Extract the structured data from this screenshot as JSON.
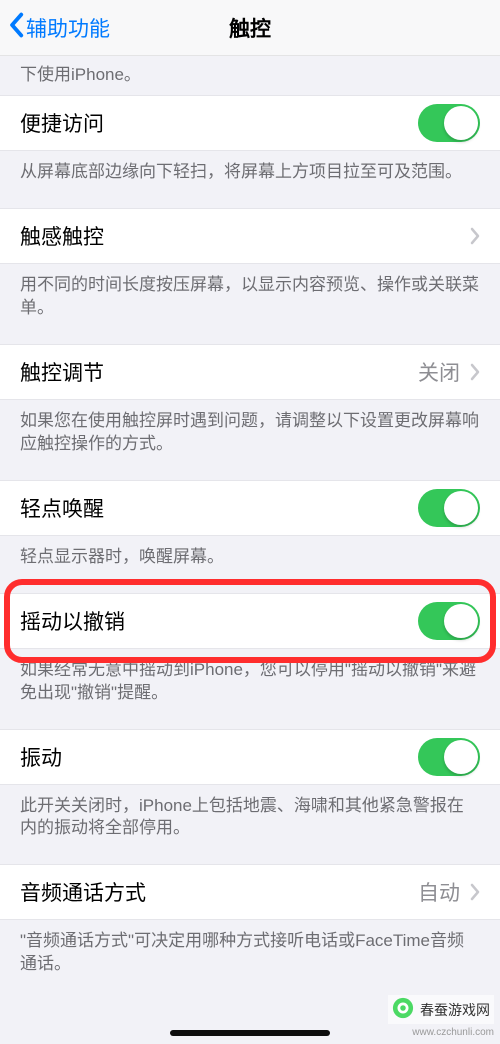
{
  "nav": {
    "back_label": "辅助功能",
    "title": "触控"
  },
  "cut_footer": "下使用iPhone。",
  "rows": {
    "reachability": {
      "label": "便捷访问",
      "footer": "从屏幕底部边缘向下轻扫，将屏幕上方项目拉至可及范围。"
    },
    "haptic": {
      "label": "触感触控",
      "footer": "用不同的时间长度按压屏幕，以显示内容预览、操作或关联菜单。"
    },
    "accommodations": {
      "label": "触控调节",
      "value": "关闭",
      "footer": "如果您在使用触控屏时遇到问题，请调整以下设置更改屏幕响应触控操作的方式。"
    },
    "tap_wake": {
      "label": "轻点唤醒",
      "footer": "轻点显示器时，唤醒屏幕。"
    },
    "shake": {
      "label": "摇动以撤销",
      "footer": "如果经常无意中摇动到iPhone，您可以停用\"摇动以撤销\"来避免出现\"撤销\"提醒。"
    },
    "vibration": {
      "label": "振动",
      "footer": "此开关关闭时，iPhone上包括地震、海啸和其他紧急警报在内的振动将全部停用。"
    },
    "audio_routing": {
      "label": "音频通话方式",
      "value": "自动",
      "footer": "\"音频通话方式\"可决定用哪种方式接听电话或FaceTime音频通话。"
    }
  },
  "watermark": {
    "text": "春蚕游戏网",
    "url": "www.czchunli.com"
  },
  "highlight_row": "shake"
}
